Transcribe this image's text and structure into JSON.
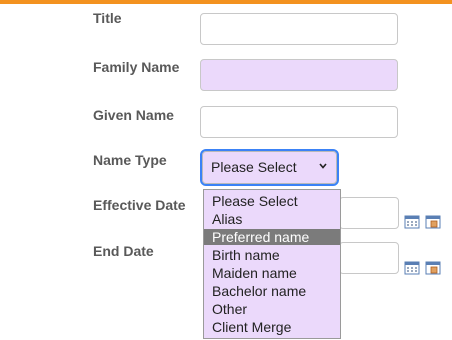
{
  "header": {
    "accent_color": "#f39220"
  },
  "form": {
    "title_label": "Title",
    "family_name_label": "Family Name",
    "given_name_label": "Given Name",
    "name_type_label": "Name Type",
    "effective_date_label": "Effective Date",
    "end_date_label": "End Date",
    "title_value": "",
    "family_name_value": "",
    "given_name_value": "",
    "required_field_color": "#ebd9fb"
  },
  "name_type_select": {
    "selected": "Please Select",
    "options": [
      "Please Select",
      "Alias",
      "Preferred name",
      "Birth name",
      "Maiden name",
      "Bachelor name",
      "Other",
      "Client Merge"
    ],
    "highlighted": "Preferred name"
  },
  "icons": {
    "date_picker": "calendar-icon"
  }
}
